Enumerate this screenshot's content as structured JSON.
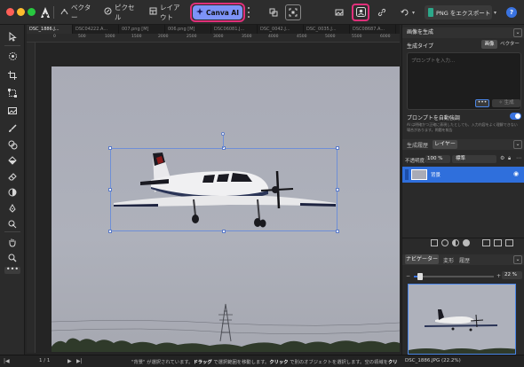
{
  "topbar": {
    "vector_label": "ベクター",
    "pixel_label": "ピクセル",
    "layout_label": "レイアウト",
    "canva_ai_label": "Canva AI",
    "export_label": "PNG をエクスポート",
    "help_label": "?"
  },
  "tabs": [
    {
      "label": "DSC_1886.J..."
    },
    {
      "label": "DSC04222.A..."
    },
    {
      "label": "007.png [M]"
    },
    {
      "label": "006.png [M]"
    },
    {
      "label": "DSC06081.J..."
    },
    {
      "label": "DSC_0042.J..."
    },
    {
      "label": "DSC_0035.J..."
    },
    {
      "label": "DSC08687.A..."
    }
  ],
  "ruler": {
    "marks": [
      "0",
      "500",
      "1000",
      "1500",
      "2000",
      "2500",
      "3000",
      "3500",
      "4000",
      "4500",
      "5000",
      "5500",
      "6000"
    ]
  },
  "right_panel": {
    "gen_header": "画像を生成",
    "gen_type_label": "生成タイプ",
    "type_image": "画像",
    "type_vector": "ベクター",
    "prompt_placeholder": "プロンプトを入力...",
    "generate_label": "生成",
    "auto_enhance_label": "プロンプトを自動強調",
    "auto_enhance_desc": "AI は明確かつ正確に表現したとしても、入力内容をよく理解できない場合があります。問題を報告",
    "history_tab": "生成履歴",
    "layers_tab": "レイヤー",
    "opacity_label": "不透明度:",
    "opacity_value": "100 %",
    "blend_mode": "標準",
    "layer_name": "背景",
    "navigator_tab": "ナビゲーター",
    "transform_tab": "変形",
    "history_tab2": "履歴",
    "zoom_value": "22 %"
  },
  "status": {
    "page": "1 / 1",
    "msg_part1": "\"背景\" が選択されています。",
    "msg_drag": "ドラッグ",
    "msg_part2": " で選択範囲を移動します。",
    "msg_click": "クリック",
    "msg_part3": " で別のオブジェクトを選択します。空の領域を",
    "msg_click2": "クリ",
    "file_info": "DSC_1886.JPG (22.2%)"
  },
  "colors": {
    "canva_accent": "#7d93f7",
    "highlight_border": "#e0307a",
    "selection": "#2f6fdc"
  }
}
